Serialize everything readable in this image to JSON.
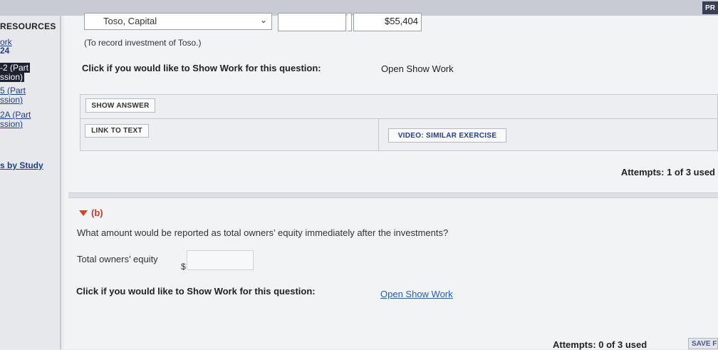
{
  "header": {
    "pr_label": "PR"
  },
  "sidebar": {
    "heading": "RESOURCES",
    "items": [
      {
        "label": "ork"
      },
      {
        "label": "24"
      },
      {
        "label": "-2 (Part"
      },
      {
        "label": "ssion)"
      },
      {
        "label": "5 (Part"
      },
      {
        "label": "ssion)"
      },
      {
        "label": "2A (Part"
      },
      {
        "label": "ssion)"
      },
      {
        "label": "s by Study"
      }
    ]
  },
  "part_a": {
    "account_select": "Toso, Capital",
    "amount": "$55,404",
    "note": "(To record investment of Toso.)",
    "show_work_question": "Click if you would like to Show Work for this question:",
    "show_work_link": "Open Show Work",
    "buttons": {
      "show_answer": "SHOW ANSWER",
      "link_to_text": "LINK TO TEXT",
      "video": "VIDEO: SIMILAR EXERCISE"
    },
    "attempts": "Attempts: 1 of 3 used"
  },
  "part_b": {
    "label": "(b)",
    "question": "What amount would be reported as total owners’ equity immediately after the investments?",
    "field_label": "Total owners’ equity",
    "currency": "$",
    "value": "",
    "show_work_question": "Click if you would like to Show Work for this question:",
    "show_work_link": "Open Show Work",
    "attempts": "Attempts: 0 of 3 used",
    "save_label": "SAVE F"
  },
  "colors": {
    "accent_red": "#d9402d",
    "link_blue": "#2a5db0",
    "active_nav": "#1e2230"
  },
  "icons": {
    "select_chevron": "chevron-down-icon",
    "collapse_caret": "caret-down-icon"
  }
}
